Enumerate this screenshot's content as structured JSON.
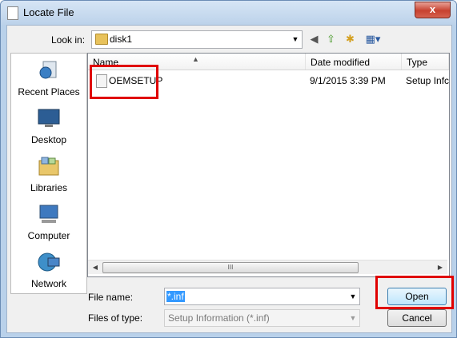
{
  "window": {
    "title": "Locate File",
    "close_glyph": "x"
  },
  "toolbar": {
    "lookin_label": "Look in:",
    "lookin_value": "disk1",
    "icons": [
      "back-icon",
      "up-folder-icon",
      "new-folder-icon",
      "view-menu-icon"
    ]
  },
  "places": [
    {
      "label": "Recent Places",
      "icon": "recent-places-icon"
    },
    {
      "label": "Desktop",
      "icon": "desktop-icon"
    },
    {
      "label": "Libraries",
      "icon": "libraries-icon"
    },
    {
      "label": "Computer",
      "icon": "computer-icon"
    },
    {
      "label": "Network",
      "icon": "network-icon"
    }
  ],
  "filelist": {
    "columns": [
      "Name",
      "Date modified",
      "Type"
    ],
    "rows": [
      {
        "name": "OEMSETUP",
        "date": "9/1/2015 3:39 PM",
        "type": "Setup Infc"
      }
    ],
    "scroll_grip": "III"
  },
  "form": {
    "filename_label": "File name:",
    "filename_value": "*.inf",
    "filetype_label": "Files of type:",
    "filetype_value": "Setup Information (*.inf)"
  },
  "buttons": {
    "open": "Open",
    "cancel": "Cancel"
  },
  "colors": {
    "highlight": "#e00000",
    "selection": "#3399ff"
  }
}
